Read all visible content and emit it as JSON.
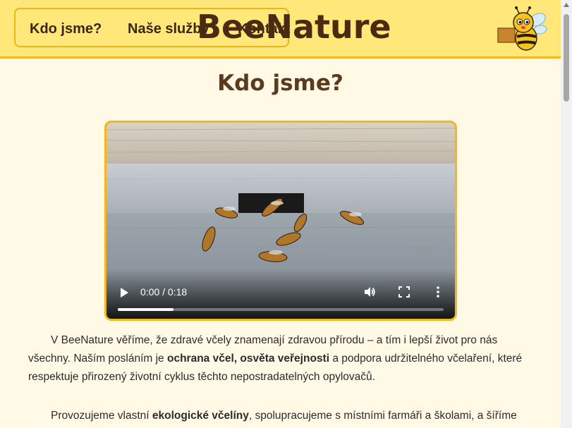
{
  "header": {
    "nav": [
      {
        "label": "Kdo jsme?"
      },
      {
        "label": "Naše služby"
      },
      {
        "label": "Kontakt"
      }
    ],
    "brand": "BeeNature"
  },
  "main": {
    "heading": "Kdo jsme?",
    "video": {
      "time": "0:00 / 0:18",
      "progress": 0.17
    },
    "paragraph1": {
      "part1": "V BeeNature věříme, že zdravé včely znamenají zdravou přírodu – a tím i lepší život pro nás všechny. Naším posláním je ",
      "bold1": "ochrana včel, osvěta veřejnosti",
      "part2": " a podpora udržitelného včelaření, které respektuje přirozený životní cyklus těchto nepostradatelných opylovačů."
    },
    "paragraph2": {
      "part1": "Provozujeme vlastní ",
      "bold1": "ekologické včelíny",
      "part2": ", spolupracujeme s místními farmáři a školami, a šíříme"
    }
  },
  "colors": {
    "header_bg": "#ffe77a",
    "accent": "#f5b51c",
    "brand_text": "#4a2b12",
    "page_bg": "#fff9e6"
  }
}
